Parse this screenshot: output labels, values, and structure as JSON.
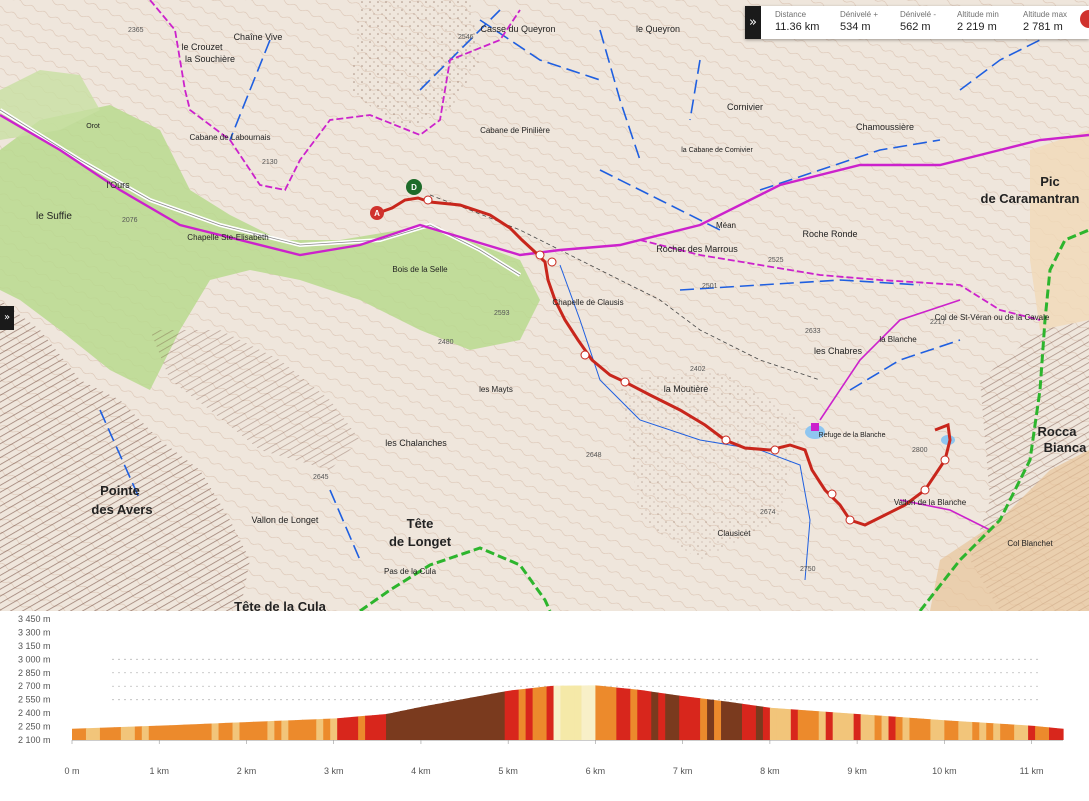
{
  "stats": [
    {
      "label": "Distance",
      "value": "11.36 km"
    },
    {
      "label": "Dénivelé +",
      "value": "534 m"
    },
    {
      "label": "Dénivelé -",
      "value": "562 m"
    },
    {
      "label": "Altitude min",
      "value": "2 219 m"
    },
    {
      "label": "Altitude max",
      "value": "2 781 m"
    }
  ],
  "toolbar": {
    "collapse_glyph": "»",
    "side_glyph": "»"
  },
  "colors": {
    "route": "#c8261c",
    "border_trail": "#cc22cc",
    "gr_trail": "#2db52d",
    "water": "#1f5fe0",
    "meadow": "#b9d98e",
    "terrain": "#efe6dc",
    "rock": "#6b3a2a"
  },
  "map": {
    "markers": {
      "start": "D",
      "arrival": "A"
    },
    "places": [
      {
        "text": "Chaîne Vive",
        "big": false
      },
      {
        "text": "la Souchière",
        "big": false
      },
      {
        "text": "Casse du Queyron",
        "big": false
      },
      {
        "text": "le Queyron",
        "big": false
      },
      {
        "text": "le Crouzet",
        "big": false
      },
      {
        "text": "Cabane de Labournais",
        "big": false
      },
      {
        "text": "Cabane de Pinilière",
        "big": false
      },
      {
        "text": "Cornivier",
        "big": false
      },
      {
        "text": "Chamoussière",
        "big": false
      },
      {
        "text": "la Cabane de Cornivier",
        "big": false
      },
      {
        "text": "Pic",
        "big": true
      },
      {
        "text": "de Caramantran",
        "big": true
      },
      {
        "text": "Chapelle Ste-Elisabeth",
        "big": false
      },
      {
        "text": "le Suffie",
        "big": false
      },
      {
        "text": "l'Ours",
        "big": false
      },
      {
        "text": "Orot",
        "big": false
      },
      {
        "text": "Rocher des Marrous",
        "big": false
      },
      {
        "text": "Méan",
        "big": false
      },
      {
        "text": "Roche Ronde",
        "big": false
      },
      {
        "text": "Bois de la Selle",
        "big": false
      },
      {
        "text": "Chapelle de Clausis",
        "big": false
      },
      {
        "text": "Col de St-Véran ou de la Cavale",
        "big": false
      },
      {
        "text": "la Blanche",
        "big": false
      },
      {
        "text": "les Chabres",
        "big": false
      },
      {
        "text": "la Moutière",
        "big": false
      },
      {
        "text": "les Mayts",
        "big": false
      },
      {
        "text": "les Chalanches",
        "big": false
      },
      {
        "text": "Refuge de la Blanche",
        "big": false
      },
      {
        "text": "Rocca",
        "big": true
      },
      {
        "text": "Bianca",
        "big": true
      },
      {
        "text": "Pointe",
        "big": true
      },
      {
        "text": "des Avers",
        "big": true
      },
      {
        "text": "Vallon de Longet",
        "big": false
      },
      {
        "text": "Tête",
        "big": true
      },
      {
        "text": "de Longet",
        "big": true
      },
      {
        "text": "Pas de la Cula",
        "big": false
      },
      {
        "text": "Clausicet",
        "big": false
      },
      {
        "text": "Vallon de la Blanche",
        "big": false
      },
      {
        "text": "Col Blanchet",
        "big": false
      },
      {
        "text": "Tête de la Cula",
        "big": true
      }
    ],
    "elevations": [
      "2365",
      "2546",
      "2130",
      "2076",
      "2525",
      "2501",
      "2593",
      "2480",
      "2402",
      "2633",
      "2648",
      "2674",
      "2750",
      "2645",
      "2800",
      "2217"
    ]
  },
  "profile": {
    "y_ticks": [
      "3 450 m",
      "3 300 m",
      "3 150 m",
      "3 000 m",
      "2 850 m",
      "2 700 m",
      "2 550 m",
      "2 400 m",
      "2 250 m",
      "2 100 m"
    ],
    "x_ticks": [
      "0 m",
      "1 km",
      "2 km",
      "3 km",
      "4 km",
      "5 km",
      "6 km",
      "7 km",
      "8 km",
      "9 km",
      "10 km",
      "11 km"
    ]
  },
  "chart_data": {
    "type": "area",
    "title": "",
    "xlabel": "",
    "ylabel": "",
    "x_unit": "km",
    "y_unit": "m",
    "xlim": [
      0,
      11.36
    ],
    "ylim": [
      2100,
      3450
    ],
    "x": [
      0,
      1,
      2,
      3,
      3.6,
      4,
      4.5,
      5,
      5.5,
      6,
      6.5,
      7,
      7.5,
      8,
      9,
      10,
      11,
      11.36
    ],
    "series": [
      {
        "values": [
          2225,
          2260,
          2300,
          2340,
          2390,
          2470,
          2560,
          2650,
          2705,
          2710,
          2660,
          2590,
          2530,
          2460,
          2390,
          2320,
          2260,
          2225
        ]
      }
    ],
    "slope_colors": [
      "#f5e9a8",
      "#f2c57a",
      "#ec8a2c",
      "#d8261c",
      "#7a3a1e",
      "#f8f0c8"
    ],
    "grid": true
  }
}
